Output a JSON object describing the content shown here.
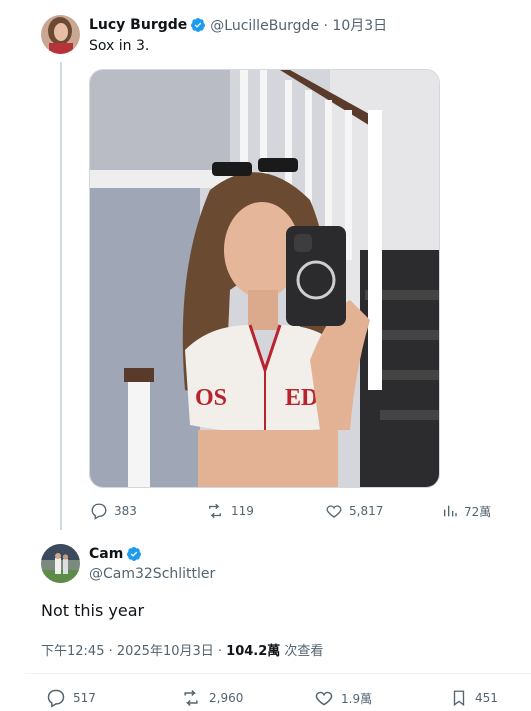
{
  "original_tweet": {
    "author_name": "Lucy Burgde",
    "handle_date": "@LucilleBurgde · 10月3日",
    "text": "Sox in 3.",
    "actions": {
      "replies": "383",
      "reposts": "119",
      "likes": "5,817",
      "views": "72萬"
    }
  },
  "reply_tweet": {
    "author_name": "Cam",
    "handle": "@Cam32Schlittler",
    "text": "Not this year",
    "timestamp": "下午12:45 · 2025年10月3日 · ",
    "view_count": "104.2萬",
    "view_label": " 次查看",
    "actions": {
      "replies": "517",
      "reposts": "2,960",
      "likes": "1.9萬",
      "bookmarks": "451"
    }
  },
  "colors": {
    "verified": "#1d9bf0",
    "text_primary": "#0f1419",
    "text_secondary": "#536471",
    "thread_line": "#cfd9de"
  }
}
